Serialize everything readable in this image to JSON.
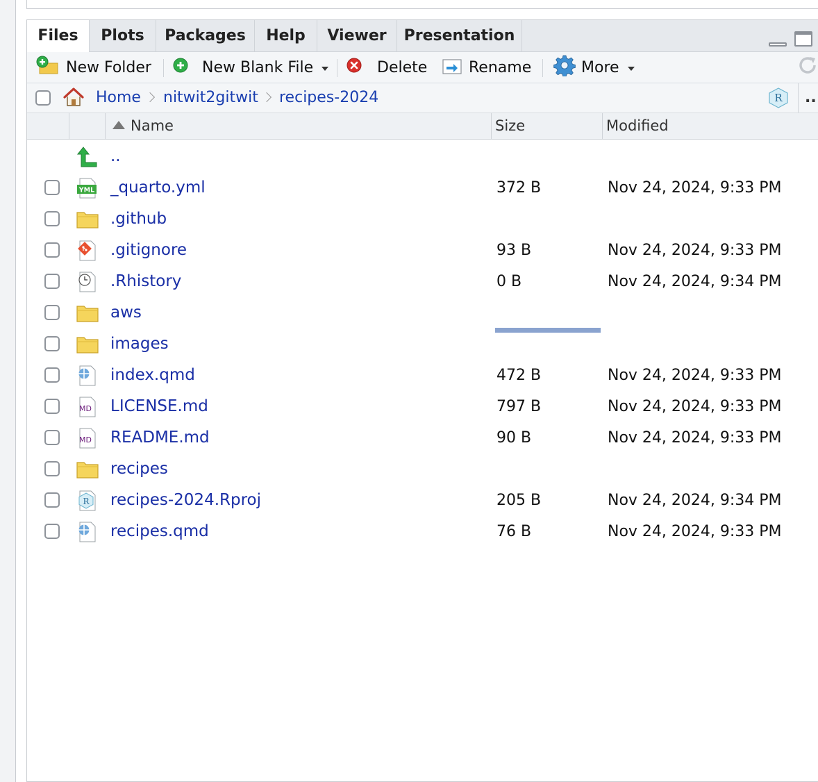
{
  "tabs": [
    {
      "label": "Files",
      "active": true
    },
    {
      "label": "Plots",
      "active": false
    },
    {
      "label": "Packages",
      "active": false
    },
    {
      "label": "Help",
      "active": false
    },
    {
      "label": "Viewer",
      "active": false
    },
    {
      "label": "Presentation",
      "active": false
    }
  ],
  "toolbar": {
    "new_folder": "New Folder",
    "new_blank_file": "New Blank File",
    "delete": "Delete",
    "rename": "Rename",
    "more": "More"
  },
  "breadcrumb": {
    "items": [
      "Home",
      "nitwit2gitwit",
      "recipes-2024"
    ],
    "overflow": "..."
  },
  "columns": {
    "name": "Name",
    "size": "Size",
    "modified": "Modified"
  },
  "parent_dir": "..",
  "files": [
    {
      "name": "_quarto.yml",
      "icon": "yml-file-icon",
      "size": "372 B",
      "modified": "Nov 24, 2024, 9:33 PM"
    },
    {
      "name": ".github",
      "icon": "folder-icon",
      "size": "",
      "modified": ""
    },
    {
      "name": ".gitignore",
      "icon": "git-file-icon",
      "size": "93 B",
      "modified": "Nov 24, 2024, 9:33 PM"
    },
    {
      "name": ".Rhistory",
      "icon": "history-file-icon",
      "size": "0 B",
      "modified": "Nov 24, 2024, 9:34 PM"
    },
    {
      "name": "aws",
      "icon": "folder-icon",
      "size": "",
      "modified": ""
    },
    {
      "name": "images",
      "icon": "folder-icon",
      "size": "",
      "modified": ""
    },
    {
      "name": "index.qmd",
      "icon": "quarto-file-icon",
      "size": "472 B",
      "modified": "Nov 24, 2024, 9:33 PM"
    },
    {
      "name": "LICENSE.md",
      "icon": "markdown-file-icon",
      "size": "797 B",
      "modified": "Nov 24, 2024, 9:33 PM"
    },
    {
      "name": "README.md",
      "icon": "markdown-file-icon",
      "size": "90 B",
      "modified": "Nov 24, 2024, 9:33 PM"
    },
    {
      "name": "recipes",
      "icon": "folder-icon",
      "size": "",
      "modified": ""
    },
    {
      "name": "recipes-2024.Rproj",
      "icon": "rproj-file-icon",
      "size": "205 B",
      "modified": "Nov 24, 2024, 9:34 PM"
    },
    {
      "name": "recipes.qmd",
      "icon": "quarto-file-icon",
      "size": "76 B",
      "modified": "Nov 24, 2024, 9:33 PM"
    }
  ],
  "loading_progress": 1.0,
  "colors": {
    "link": "#1a2fa6",
    "accent": "#1a3fb0",
    "progress": "#8aa3cf"
  }
}
